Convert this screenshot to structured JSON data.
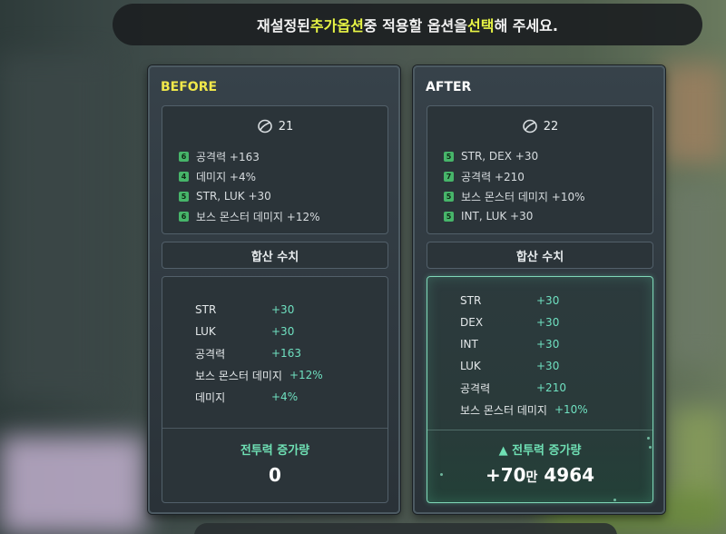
{
  "header": {
    "pre": "재설정된 ",
    "highlight1": "추가옵션",
    "mid": " 중 적용할 옵션을 ",
    "highlight2": "선택",
    "post": "해 주세요."
  },
  "before": {
    "title": "BEFORE",
    "level": "21",
    "options": [
      {
        "tier": "6",
        "text": "공격력 +163"
      },
      {
        "tier": "4",
        "text": "데미지 +4%"
      },
      {
        "tier": "5",
        "text": "STR, LUK +30"
      },
      {
        "tier": "6",
        "text": "보스 몬스터 데미지 +12%"
      }
    ],
    "sum_label": "합산 수치",
    "stats": [
      {
        "name": "STR",
        "value": "+30"
      },
      {
        "name": "LUK",
        "value": "+30"
      },
      {
        "name": "공격력",
        "value": "+163"
      },
      {
        "name": "보스 몬스터 데미지",
        "value": "+12%"
      },
      {
        "name": "데미지",
        "value": "+4%"
      }
    ],
    "power_label": "전투력 증가량",
    "power_value": "0"
  },
  "after": {
    "title": "AFTER",
    "level": "22",
    "options": [
      {
        "tier": "5",
        "text": "STR, DEX +30"
      },
      {
        "tier": "7",
        "text": "공격력 +210"
      },
      {
        "tier": "5",
        "text": "보스 몬스터 데미지 +10%"
      },
      {
        "tier": "5",
        "text": "INT, LUK +30"
      }
    ],
    "sum_label": "합산 수치",
    "stats": [
      {
        "name": "STR",
        "value": "+30"
      },
      {
        "name": "DEX",
        "value": "+30"
      },
      {
        "name": "INT",
        "value": "+30"
      },
      {
        "name": "LUK",
        "value": "+30"
      },
      {
        "name": "공격력",
        "value": "+210"
      },
      {
        "name": "보스 몬스터 데미지",
        "value": "+10%"
      }
    ],
    "power_label": "▲ 전투력 증가량",
    "power_value_main": "+70",
    "power_value_unit": "만",
    "power_value_rest": " 4964"
  },
  "colors": {
    "accent_yellow": "#e8f545",
    "stat_teal": "#6fe0c0",
    "badge_green": "#47b56a"
  }
}
